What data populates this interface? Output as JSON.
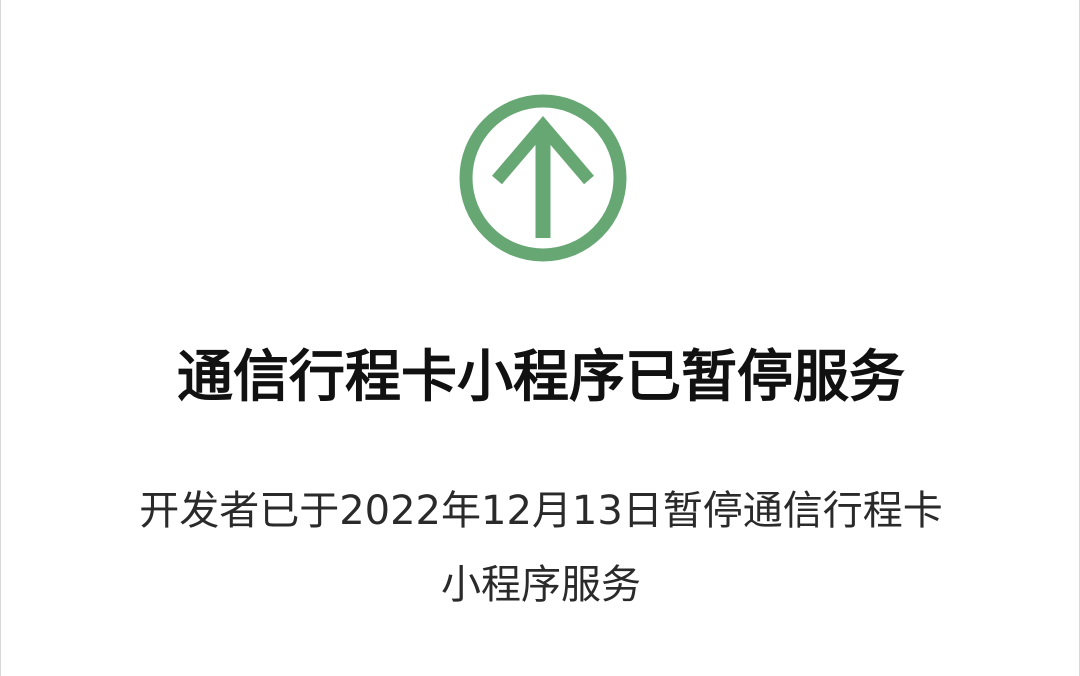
{
  "icon": {
    "name": "arrow-up-circle-icon",
    "color": "#67A774"
  },
  "title": "通信行程卡小程序已暂停服务",
  "description": {
    "line1": "开发者已于2022年12月13日暂停通信行程卡",
    "line2": "小程序服务"
  }
}
